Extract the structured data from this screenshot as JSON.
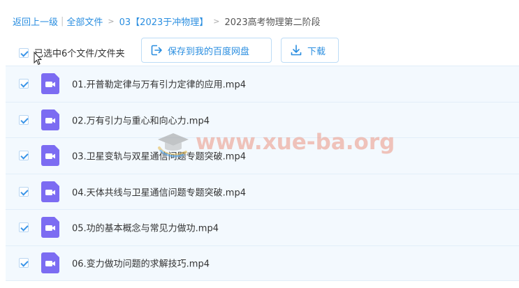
{
  "breadcrumb": {
    "back": "返回上一级",
    "all_files": "全部文件",
    "folder": "03【2023于冲物理】",
    "current": "2023高考物理第二阶段"
  },
  "toolbar": {
    "selected_text": "已选中6个文件/文件夹",
    "save_label": "保存到我的百度网盘",
    "download_label": "下载"
  },
  "files": [
    {
      "name": "01.开普勒定律与万有引力定律的应用.mp4"
    },
    {
      "name": "02.万有引力与重心和向心力.mp4"
    },
    {
      "name": "03.卫星变轨与双星通信问题专题突破.mp4"
    },
    {
      "name": "04.天体共线与卫星通信问题专题突破.mp4"
    },
    {
      "name": "05.功的基本概念与常见力做功.mp4"
    },
    {
      "name": "06.变力做功问题的求解技巧.mp4"
    }
  ],
  "watermark": {
    "text": "www.xue-ba.org"
  },
  "colors": {
    "accent": "#2a8ee0",
    "video_icon": "#7c6cf2",
    "row_bg": "#f3f9fe"
  }
}
